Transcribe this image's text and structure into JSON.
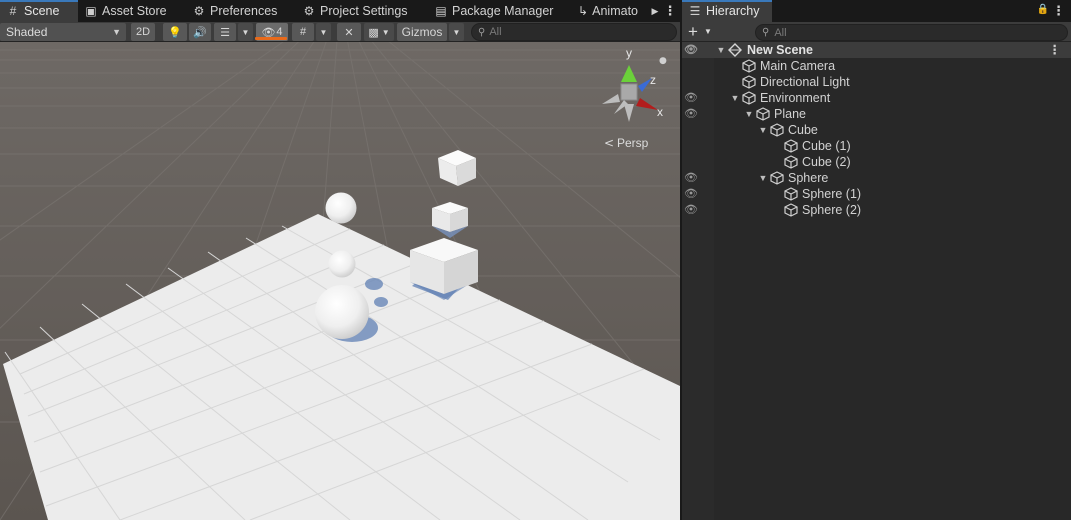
{
  "scene_tabs": [
    {
      "label": "Scene",
      "icon": "grid-icon"
    },
    {
      "label": "Asset Store",
      "icon": "bag-icon"
    },
    {
      "label": "Preferences",
      "icon": "gear-icon"
    },
    {
      "label": "Project Settings",
      "icon": "gear-icon"
    },
    {
      "label": "Package Manager",
      "icon": "package-icon"
    },
    {
      "label": "Animato",
      "icon": "animation-icon"
    }
  ],
  "toolbar": {
    "draw_mode": "Shaded",
    "two_d_label": "2D",
    "hidden_count": "4",
    "gizmos_label": "Gizmos",
    "search_placeholder": "All"
  },
  "viewport": {
    "projection_label": "Persp",
    "axis_y": "y",
    "axis_z": "z",
    "axis_x": "x"
  },
  "hierarchy": {
    "tab_label": "Hierarchy",
    "search_placeholder": "All",
    "rows": [
      {
        "label": "New Scene",
        "depth": 0,
        "type": "scene",
        "expanded": true,
        "hidden": true
      },
      {
        "label": "Main Camera",
        "depth": 1,
        "type": "object",
        "hidden": false
      },
      {
        "label": "Directional Light",
        "depth": 1,
        "type": "object",
        "hidden": false
      },
      {
        "label": "Environment",
        "depth": 1,
        "type": "object",
        "expanded": true,
        "hidden": true
      },
      {
        "label": "Plane",
        "depth": 2,
        "type": "object",
        "expanded": true,
        "hidden": true
      },
      {
        "label": "Cube",
        "depth": 3,
        "type": "object",
        "expanded": true,
        "hidden": false
      },
      {
        "label": "Cube (1)",
        "depth": 4,
        "type": "object",
        "hidden": false
      },
      {
        "label": "Cube (2)",
        "depth": 4,
        "type": "object",
        "hidden": false
      },
      {
        "label": "Sphere",
        "depth": 3,
        "type": "object",
        "expanded": true,
        "hidden": true
      },
      {
        "label": "Sphere (1)",
        "depth": 4,
        "type": "object",
        "hidden": true
      },
      {
        "label": "Sphere (2)",
        "depth": 4,
        "type": "object",
        "hidden": true
      }
    ]
  },
  "colors": {
    "accent_blue": "#3a79bb",
    "hidden_count_bar": "#e86a1b",
    "panel_bg": "#282828",
    "toolbar_bg": "#3c3c3c"
  }
}
